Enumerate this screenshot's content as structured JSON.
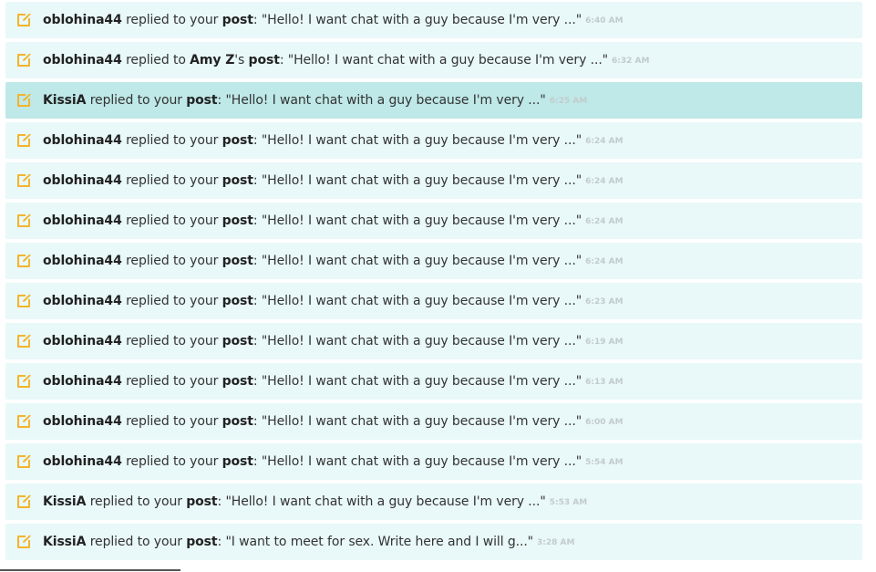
{
  "icon": "edit-icon",
  "accent_color": "#f2b52c",
  "notifications": [
    {
      "user": "oblohina44",
      "mid": " replied to your ",
      "owner": "",
      "owner_suffix": "",
      "object": "post",
      "quote": ": \"Hello! I want chat with a guy because I'm very ...\"",
      "time": "6:40 AM",
      "highlight": false
    },
    {
      "user": "oblohina44",
      "mid": " replied to ",
      "owner": "Amy Z",
      "owner_suffix": "'s ",
      "object": "post",
      "quote": ": \"Hello! I want chat with a guy because I'm very ...\"",
      "time": "6:32 AM",
      "highlight": false
    },
    {
      "user": "KissiA",
      "mid": " replied to your ",
      "owner": "",
      "owner_suffix": "",
      "object": "post",
      "quote": ": \"Hello! I want chat with a guy because I'm very ...\"",
      "time": "6:25 AM",
      "highlight": true
    },
    {
      "user": "oblohina44",
      "mid": " replied to your ",
      "owner": "",
      "owner_suffix": "",
      "object": "post",
      "quote": ": \"Hello! I want chat with a guy because I'm very ...\"",
      "time": "6:24 AM",
      "highlight": false
    },
    {
      "user": "oblohina44",
      "mid": " replied to your ",
      "owner": "",
      "owner_suffix": "",
      "object": "post",
      "quote": ": \"Hello! I want chat with a guy because I'm very ...\"",
      "time": "6:24 AM",
      "highlight": false
    },
    {
      "user": "oblohina44",
      "mid": " replied to your ",
      "owner": "",
      "owner_suffix": "",
      "object": "post",
      "quote": ": \"Hello! I want chat with a guy because I'm very ...\"",
      "time": "6:24 AM",
      "highlight": false
    },
    {
      "user": "oblohina44",
      "mid": " replied to your ",
      "owner": "",
      "owner_suffix": "",
      "object": "post",
      "quote": ": \"Hello! I want chat with a guy because I'm very ...\"",
      "time": "6:24 AM",
      "highlight": false
    },
    {
      "user": "oblohina44",
      "mid": " replied to your ",
      "owner": "",
      "owner_suffix": "",
      "object": "post",
      "quote": ": \"Hello! I want chat with a guy because I'm very ...\"",
      "time": "6:23 AM",
      "highlight": false
    },
    {
      "user": "oblohina44",
      "mid": " replied to your ",
      "owner": "",
      "owner_suffix": "",
      "object": "post",
      "quote": ": \"Hello! I want chat with a guy because I'm very ...\"",
      "time": "6:19 AM",
      "highlight": false
    },
    {
      "user": "oblohina44",
      "mid": " replied to your ",
      "owner": "",
      "owner_suffix": "",
      "object": "post",
      "quote": ": \"Hello! I want chat with a guy because I'm very ...\"",
      "time": "6:13 AM",
      "highlight": false
    },
    {
      "user": "oblohina44",
      "mid": " replied to your ",
      "owner": "",
      "owner_suffix": "",
      "object": "post",
      "quote": ": \"Hello! I want chat with a guy because I'm very ...\"",
      "time": "6:00 AM",
      "highlight": false
    },
    {
      "user": "oblohina44",
      "mid": " replied to your ",
      "owner": "",
      "owner_suffix": "",
      "object": "post",
      "quote": ": \"Hello! I want chat with a guy because I'm very ...\"",
      "time": "5:54 AM",
      "highlight": false
    },
    {
      "user": "KissiA",
      "mid": " replied to your ",
      "owner": "",
      "owner_suffix": "",
      "object": "post",
      "quote": ": \"Hello! I want chat with a guy because I'm very ...\"",
      "time": "5:53 AM",
      "highlight": false
    },
    {
      "user": "KissiA",
      "mid": " replied to your ",
      "owner": "",
      "owner_suffix": "",
      "object": "post",
      "quote": ": \"I want to meet for sex. Write here and I will g...\"",
      "time": "3:28 AM",
      "highlight": false
    }
  ]
}
